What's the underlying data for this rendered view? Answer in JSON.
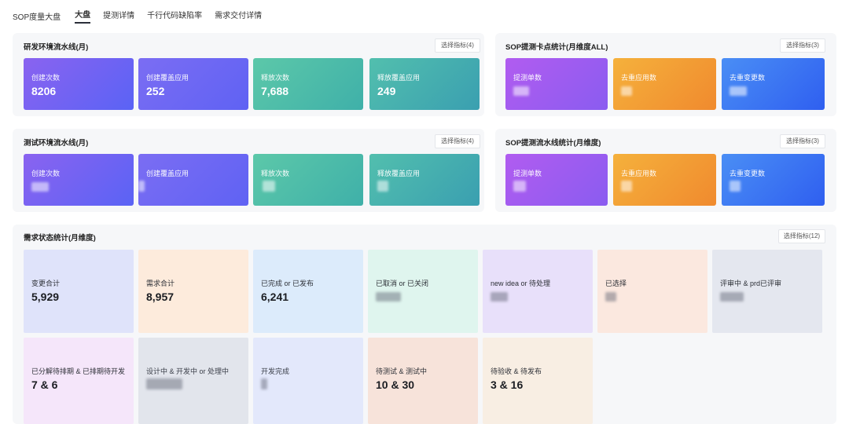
{
  "nav": {
    "brand": "SOP度量大盘",
    "tabs": [
      "大盘",
      "提测详情",
      "千行代码缺陷率",
      "需求交付详情"
    ]
  },
  "panels": {
    "dev": {
      "title": "研发环境流水线(月)",
      "select": "选择指标(4)",
      "cards": [
        {
          "label": "创建次数",
          "value": "8206"
        },
        {
          "label": "创建覆盖应用",
          "value": "252"
        },
        {
          "label": "释放次数",
          "value": "7,688"
        },
        {
          "label": "释放覆盖应用",
          "value": "249"
        }
      ]
    },
    "sop_points": {
      "title": "SOP提测卡点统计(月维度ALL)",
      "select": "选择指标(3)",
      "cards": [
        {
          "label": "提测单数"
        },
        {
          "label": "去重应用数"
        },
        {
          "label": "去重变更数"
        }
      ]
    },
    "test": {
      "title": "测试环境流水线(月)",
      "select": "选择指标(4)",
      "cards": [
        {
          "label": "创建次数"
        },
        {
          "label": "创建覆盖应用"
        },
        {
          "label": "释放次数"
        },
        {
          "label": "释放覆盖应用"
        }
      ]
    },
    "sop_pipeline": {
      "title": "SOP提测流水线统计(月维度)",
      "select": "选择指标(3)",
      "cards": [
        {
          "label": "提测单数"
        },
        {
          "label": "去重应用数"
        },
        {
          "label": "去重变更数"
        }
      ]
    },
    "status": {
      "title": "需求状态统计(月维度)",
      "select": "选择指标(12)",
      "cards": [
        {
          "label": "变更合计",
          "value": "5,929"
        },
        {
          "label": "需求合计",
          "value": "8,957"
        },
        {
          "label": "已完成 or 已发布",
          "value": "6,241"
        },
        {
          "label": "已取消 or 已关闭"
        },
        {
          "label": "new idea or 待处理"
        },
        {
          "label": "已选择"
        },
        {
          "label": "评审中 & prd已评审"
        },
        {
          "label": "已分解待排期 & 已排期待开发",
          "value": "7 & 6"
        },
        {
          "label": "设计中 & 开发中 or 处理中"
        },
        {
          "label": "开发完成"
        },
        {
          "label": "待测试 & 测试中",
          "value": "10 & 30"
        },
        {
          "label": "待验收 & 待发布",
          "value": "3 & 16"
        }
      ]
    }
  },
  "colors": {
    "purple": "#6e62f2",
    "indigo": "#6b71f5",
    "teal": "#4fbfb0",
    "cyan": "#3fa9b5",
    "violet": "#9b5cf0",
    "orange": "#f4a23a",
    "blue": "#3f78f2"
  }
}
